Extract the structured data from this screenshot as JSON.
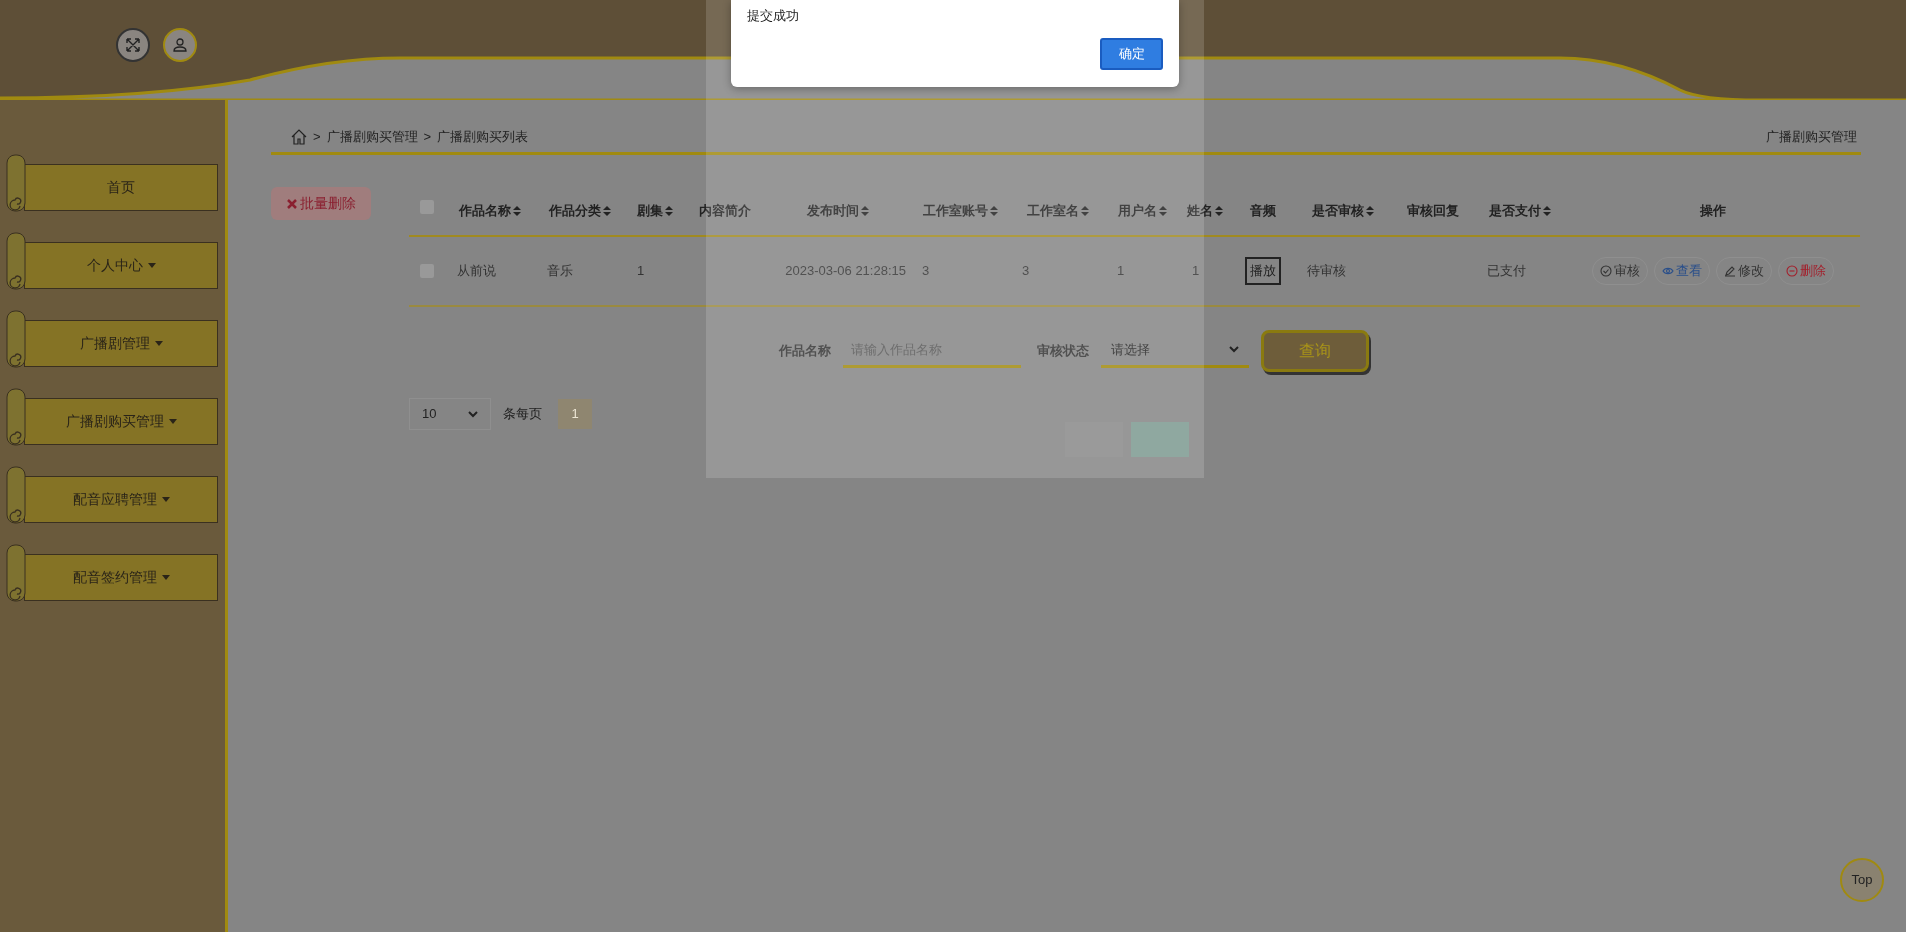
{
  "header": {
    "icons": [
      {
        "kind": "fullscreen"
      },
      {
        "kind": "user"
      }
    ]
  },
  "sidebar": {
    "items": [
      {
        "label": "首页",
        "has_menu": false
      },
      {
        "label": "个人中心",
        "has_menu": true
      },
      {
        "label": "广播剧管理",
        "has_menu": true
      },
      {
        "label": "广播剧购买管理",
        "has_menu": true
      },
      {
        "label": "配音应聘管理",
        "has_menu": true
      },
      {
        "label": "配音签约管理",
        "has_menu": true
      }
    ]
  },
  "breadcrumb": {
    "separator": ">",
    "items": [
      "广播剧购买管理",
      "广播剧购买列表"
    ]
  },
  "page_title": "广播剧购买管理",
  "batch_delete": "批量删除",
  "table": {
    "select_all_checked": false,
    "columns": [
      {
        "label": "作品名称",
        "sortable": true
      },
      {
        "label": "作品分类",
        "sortable": true
      },
      {
        "label": "剧集",
        "sortable": true
      },
      {
        "label": "内容简介",
        "sortable": false
      },
      {
        "label": "发布时间",
        "sortable": true
      },
      {
        "label": "工作室账号",
        "sortable": true
      },
      {
        "label": "工作室名",
        "sortable": true
      },
      {
        "label": "用户名",
        "sortable": true
      },
      {
        "label": "姓名",
        "sortable": true
      },
      {
        "label": "音频",
        "sortable": false
      },
      {
        "label": "是否审核",
        "sortable": true
      },
      {
        "label": "审核回复",
        "sortable": false
      },
      {
        "label": "是否支付",
        "sortable": true
      },
      {
        "label": "操作",
        "sortable": false
      }
    ],
    "rows": [
      {
        "checked": false,
        "cells": [
          "从前说",
          "音乐",
          "1",
          null,
          "2023-03-06 21:28:15",
          "3",
          "3",
          "1",
          "1",
          null,
          "待审核",
          null,
          "已支付"
        ],
        "play": "播放",
        "actions": [
          {
            "kind": "review",
            "label": "审核"
          },
          {
            "kind": "view",
            "label": "查看"
          },
          {
            "kind": "edit",
            "label": "修改"
          },
          {
            "kind": "delete",
            "label": "删除"
          }
        ]
      }
    ]
  },
  "search": {
    "name_label": "作品名称",
    "name_placeholder": "请输入作品名称",
    "status_label": "审核状态",
    "status_value": "请选择",
    "button": "查询"
  },
  "pagination": {
    "page_size": "10",
    "per_page_label": "条每页",
    "pages": [
      {
        "label": "1",
        "selected": true
      }
    ]
  },
  "top_button": "Top",
  "alert": {
    "message": "提交成功",
    "button": "确定"
  }
}
